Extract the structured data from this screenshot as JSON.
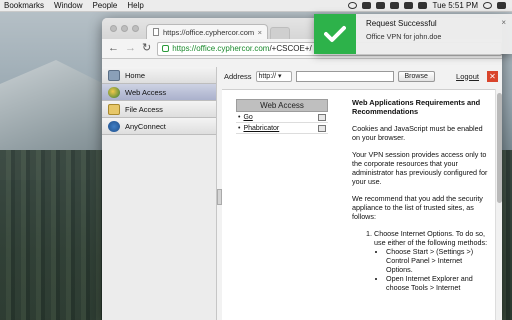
{
  "menubar": {
    "items": [
      "Bookmarks",
      "Window",
      "People",
      "Help"
    ],
    "clock": "Tue 5:51 PM"
  },
  "browser": {
    "tab_title": "https://office.cyphercor.com",
    "tab_close": "×",
    "url_secure": "https://office.cyphercor.com",
    "url_rest": "/+CSCOE+/"
  },
  "vpn": {
    "left_nav": [
      {
        "label": "Home"
      },
      {
        "label": "Web Access"
      },
      {
        "label": "File Access"
      },
      {
        "label": "AnyConnect"
      }
    ],
    "address_label": "Address",
    "protocol": "http://",
    "browse": "Browse",
    "logout": "Logout",
    "web_access": {
      "header": "Web Access",
      "links": [
        "Go",
        "Phabricator"
      ]
    },
    "help": {
      "title": "Web Applications Requirements and Recommendations",
      "p1": "Cookies and JavaScript must be enabled on your browser.",
      "p2": "Your VPN session provides access only to the corporate resources that your administrator has previously configured for your use.",
      "p3": "We recommend that you add the security appliance to the list of trusted sites, as follows:",
      "step1": "Choose Internet Options. To do so, use either of the following methods:",
      "bullet1": "Choose Start > (Settings >) Control Panel > Internet Options.",
      "bullet2": "Open Internet Explorer and choose Tools > Internet"
    }
  },
  "notification": {
    "title": "Request Successful",
    "body": "Office VPN for john.doe",
    "close": "×"
  },
  "colors": {
    "accent_green": "#2db24a",
    "active_nav": "#aab1cc",
    "logout_red": "#d9452c"
  }
}
